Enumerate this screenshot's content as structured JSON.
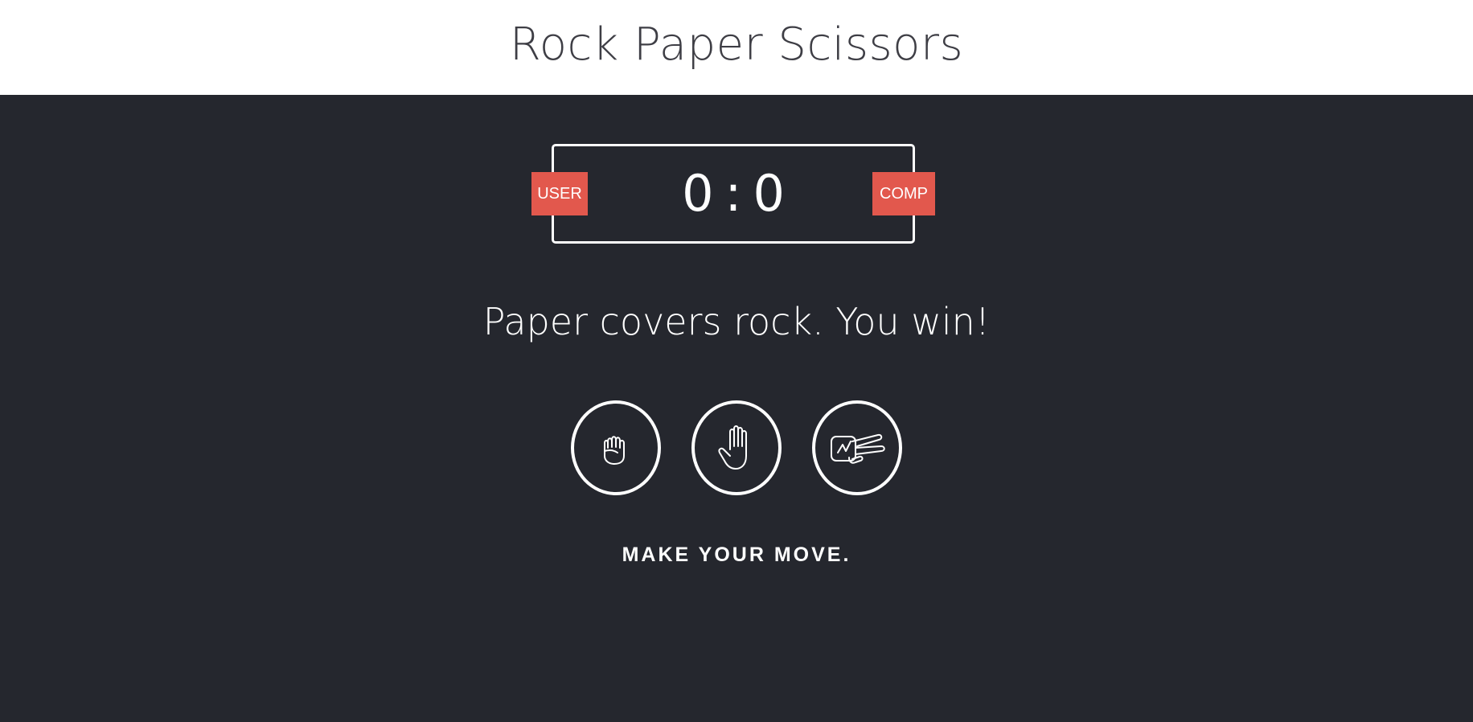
{
  "header": {
    "title": "Rock Paper Scissors"
  },
  "scoreboard": {
    "user_label": "USER",
    "comp_label": "COMP",
    "user_score": "0",
    "separator": ":",
    "comp_score": "0"
  },
  "result": {
    "message": "Paper covers rock. You win!"
  },
  "choices": [
    {
      "name": "rock",
      "icon": "fist-icon"
    },
    {
      "name": "paper",
      "icon": "open-hand-icon"
    },
    {
      "name": "scissors",
      "icon": "scissors-hand-icon"
    }
  ],
  "action": {
    "message": "MAKE YOUR MOVE."
  },
  "colors": {
    "background": "#25272e",
    "header_bg": "#ffffff",
    "badge": "#e2584d",
    "text": "#ffffff"
  }
}
